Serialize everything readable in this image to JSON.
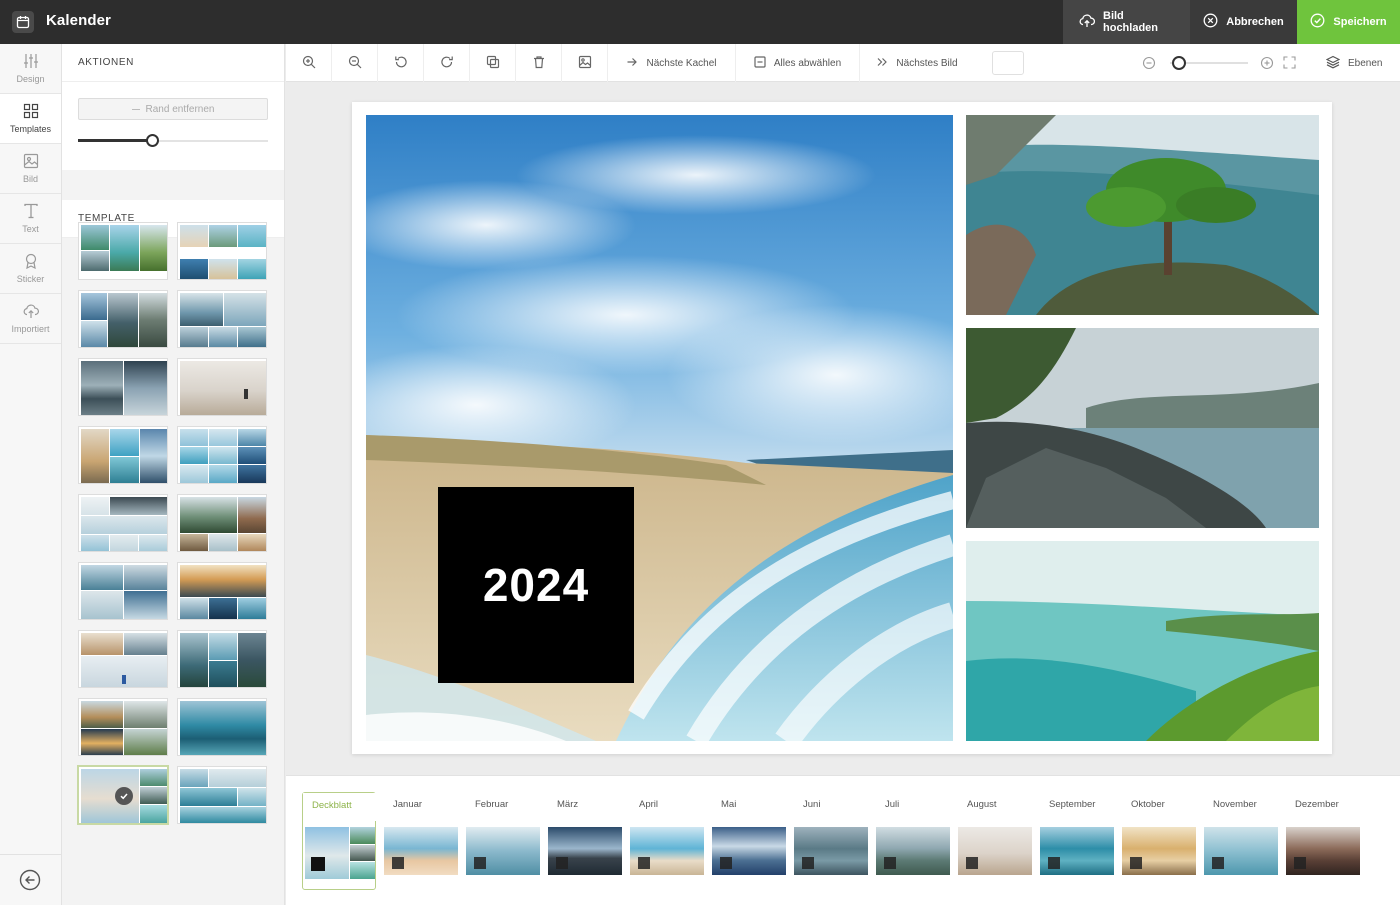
{
  "app": {
    "title": "Kalender"
  },
  "topbar": {
    "upload_label": "Bild hochladen",
    "cancel_label": "Abbrechen",
    "save_label": "Speichern",
    "save_color": "#6fc43d"
  },
  "rail": {
    "items": [
      {
        "label": "Design",
        "icon": "sliders-icon"
      },
      {
        "label": "Templates",
        "icon": "grid-icon"
      },
      {
        "label": "Bild",
        "icon": "image-icon"
      },
      {
        "label": "Text",
        "icon": "text-icon"
      },
      {
        "label": "Sticker",
        "icon": "award-icon"
      },
      {
        "label": "Importiert",
        "icon": "cloud-upload-icon"
      }
    ],
    "active": "Templates"
  },
  "panel": {
    "actions_title": "AKTIONEN",
    "remove_border_label": "Rand entfernen",
    "border_level": 0.38,
    "template_title": "TEMPLATE"
  },
  "toolbar": {
    "next_tile_label": "Nächste Kachel",
    "deselect_all_label": "Alles abwählen",
    "next_image_label": "Nächstes Bild",
    "layers_label": "Ebenen",
    "zoom_level": 0.05
  },
  "canvas": {
    "year_text": "2024"
  },
  "filmstrip": {
    "active": "Deckblatt",
    "months": [
      "Deckblatt",
      "Januar",
      "Februar",
      "März",
      "April",
      "Mai",
      "Juni",
      "Juli",
      "August",
      "September",
      "Oktober",
      "November",
      "Dezember"
    ]
  }
}
